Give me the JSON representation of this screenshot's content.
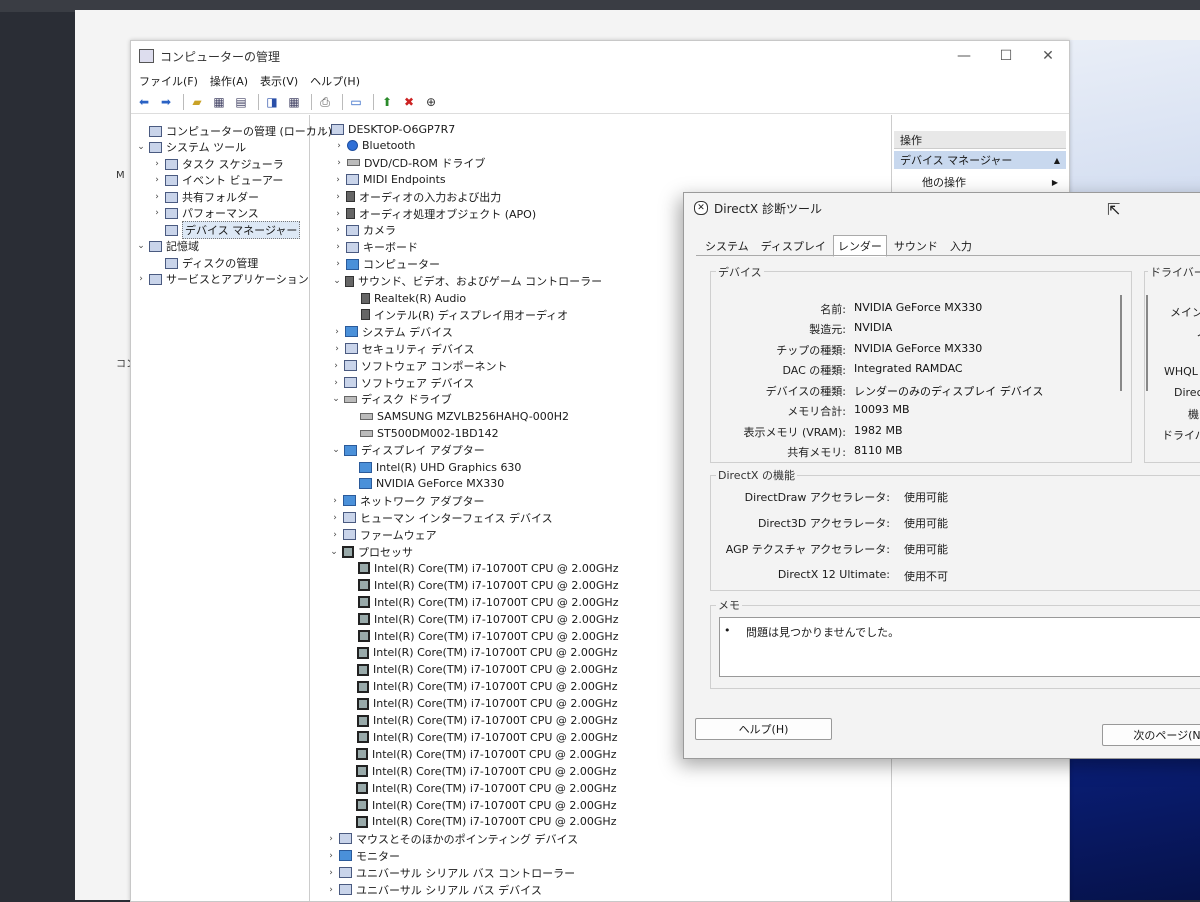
{
  "computer_management": {
    "title": "コンピューターの管理",
    "window_controls": [
      "—",
      "☐",
      "✕"
    ],
    "menu": [
      "ファイル(F)",
      "操作(A)",
      "表示(V)",
      "ヘルプ(H)"
    ],
    "left_tree": [
      {
        "label": "コンピューターの管理 (ローカル)",
        "expander": "",
        "indent": 0,
        "selected": false
      },
      {
        "label": "システム ツール",
        "expander": "⌄",
        "indent": 1,
        "selected": false
      },
      {
        "label": "タスク スケジューラ",
        "expander": "›",
        "indent": 2,
        "selected": false
      },
      {
        "label": "イベント ビューアー",
        "expander": "›",
        "indent": 2,
        "selected": false
      },
      {
        "label": "共有フォルダー",
        "expander": "›",
        "indent": 2,
        "selected": false
      },
      {
        "label": "パフォーマンス",
        "expander": "›",
        "indent": 2,
        "selected": false
      },
      {
        "label": "デバイス マネージャー",
        "expander": "",
        "indent": 2,
        "selected": true
      },
      {
        "label": "記憶域",
        "expander": "⌄",
        "indent": 1,
        "selected": false
      },
      {
        "label": "ディスクの管理",
        "expander": "",
        "indent": 2,
        "selected": false
      },
      {
        "label": "サービスとアプリケーション",
        "expander": "›",
        "indent": 1,
        "selected": false
      }
    ],
    "device_tree": [
      {
        "label": "DESKTOP-O6GP7R7",
        "expander": "⌄",
        "indent": 0,
        "icon": "computer"
      },
      {
        "label": "Bluetooth",
        "expander": "›",
        "indent": 1,
        "icon": "bluetooth"
      },
      {
        "label": "DVD/CD-ROM ドライブ",
        "expander": "›",
        "indent": 1,
        "icon": "disk"
      },
      {
        "label": "MIDI Endpoints",
        "expander": "›",
        "indent": 1,
        "icon": "device"
      },
      {
        "label": "オーディオの入力および出力",
        "expander": "›",
        "indent": 1,
        "icon": "speaker"
      },
      {
        "label": "オーディオ処理オブジェクト (APO)",
        "expander": "›",
        "indent": 1,
        "icon": "speaker"
      },
      {
        "label": "カメラ",
        "expander": "›",
        "indent": 1,
        "icon": "device"
      },
      {
        "label": "キーボード",
        "expander": "›",
        "indent": 1,
        "icon": "device"
      },
      {
        "label": "コンピューター",
        "expander": "›",
        "indent": 1,
        "icon": "monitor"
      },
      {
        "label": "サウンド、ビデオ、およびゲーム コントローラー",
        "expander": "⌄",
        "indent": 1,
        "icon": "speaker"
      },
      {
        "label": "Realtek(R) Audio",
        "expander": "",
        "indent": 2,
        "icon": "speaker"
      },
      {
        "label": "インテル(R) ディスプレイ用オーディオ",
        "expander": "",
        "indent": 2,
        "icon": "speaker"
      },
      {
        "label": "システム デバイス",
        "expander": "›",
        "indent": 1,
        "icon": "monitor"
      },
      {
        "label": "セキュリティ デバイス",
        "expander": "›",
        "indent": 1,
        "icon": "device"
      },
      {
        "label": "ソフトウェア コンポーネント",
        "expander": "›",
        "indent": 1,
        "icon": "device"
      },
      {
        "label": "ソフトウェア デバイス",
        "expander": "›",
        "indent": 1,
        "icon": "device"
      },
      {
        "label": "ディスク ドライブ",
        "expander": "⌄",
        "indent": 1,
        "icon": "disk"
      },
      {
        "label": "SAMSUNG MZVLB256HAHQ-000H2",
        "expander": "",
        "indent": 2,
        "icon": "disk"
      },
      {
        "label": "ST500DM002-1BD142",
        "expander": "",
        "indent": 2,
        "icon": "disk"
      },
      {
        "label": "ディスプレイ アダプター",
        "expander": "⌄",
        "indent": 1,
        "icon": "monitor"
      },
      {
        "label": "Intel(R) UHD Graphics 630",
        "expander": "",
        "indent": 2,
        "icon": "monitor"
      },
      {
        "label": "NVIDIA GeForce MX330",
        "expander": "",
        "indent": 2,
        "icon": "monitor"
      },
      {
        "label": "ネットワーク アダプター",
        "expander": "›",
        "indent": 1,
        "icon": "monitor"
      },
      {
        "label": "ヒューマン インターフェイス デバイス",
        "expander": "›",
        "indent": 1,
        "icon": "device"
      },
      {
        "label": "ファームウェア",
        "expander": "›",
        "indent": 1,
        "icon": "device"
      },
      {
        "label": "プロセッサ",
        "expander": "⌄",
        "indent": 1,
        "icon": "chip"
      },
      {
        "label": "Intel(R) Core(TM) i7-10700T CPU @ 2.00GHz",
        "expander": "",
        "indent": 2,
        "icon": "chip"
      },
      {
        "label": "Intel(R) Core(TM) i7-10700T CPU @ 2.00GHz",
        "expander": "",
        "indent": 2,
        "icon": "chip"
      },
      {
        "label": "Intel(R) Core(TM) i7-10700T CPU @ 2.00GHz",
        "expander": "",
        "indent": 2,
        "icon": "chip"
      },
      {
        "label": "Intel(R) Core(TM) i7-10700T CPU @ 2.00GHz",
        "expander": "",
        "indent": 2,
        "icon": "chip"
      },
      {
        "label": "Intel(R) Core(TM) i7-10700T CPU @ 2.00GHz",
        "expander": "",
        "indent": 2,
        "icon": "chip"
      },
      {
        "label": "Intel(R) Core(TM) i7-10700T CPU @ 2.00GHz",
        "expander": "",
        "indent": 2,
        "icon": "chip"
      },
      {
        "label": "Intel(R) Core(TM) i7-10700T CPU @ 2.00GHz",
        "expander": "",
        "indent": 2,
        "icon": "chip"
      },
      {
        "label": "Intel(R) Core(TM) i7-10700T CPU @ 2.00GHz",
        "expander": "",
        "indent": 2,
        "icon": "chip"
      },
      {
        "label": "Intel(R) Core(TM) i7-10700T CPU @ 2.00GHz",
        "expander": "",
        "indent": 2,
        "icon": "chip"
      },
      {
        "label": "Intel(R) Core(TM) i7-10700T CPU @ 2.00GHz",
        "expander": "",
        "indent": 2,
        "icon": "chip"
      },
      {
        "label": "Intel(R) Core(TM) i7-10700T CPU @ 2.00GHz",
        "expander": "",
        "indent": 2,
        "icon": "chip"
      },
      {
        "label": "Intel(R) Core(TM) i7-10700T CPU @ 2.00GHz",
        "expander": "",
        "indent": 2,
        "icon": "chip"
      },
      {
        "label": "Intel(R) Core(TM) i7-10700T CPU @ 2.00GHz",
        "expander": "",
        "indent": 2,
        "icon": "chip"
      },
      {
        "label": "Intel(R) Core(TM) i7-10700T CPU @ 2.00GHz",
        "expander": "",
        "indent": 2,
        "icon": "chip"
      },
      {
        "label": "Intel(R) Core(TM) i7-10700T CPU @ 2.00GHz",
        "expander": "",
        "indent": 2,
        "icon": "chip"
      },
      {
        "label": "Intel(R) Core(TM) i7-10700T CPU @ 2.00GHz",
        "expander": "",
        "indent": 2,
        "icon": "chip"
      },
      {
        "label": "マウスとそのほかのポインティング デバイス",
        "expander": "›",
        "indent": 1,
        "icon": "device"
      },
      {
        "label": "モニター",
        "expander": "›",
        "indent": 1,
        "icon": "monitor"
      },
      {
        "label": "ユニバーサル シリアル バス コントローラー",
        "expander": "›",
        "indent": 1,
        "icon": "device"
      },
      {
        "label": "ユニバーサル シリアル バス デバイス",
        "expander": "›",
        "indent": 1,
        "icon": "device"
      }
    ],
    "actions": {
      "header": "操作",
      "selected": "デバイス マネージャー",
      "item": "他の操作"
    }
  },
  "directx": {
    "title": "DirectX 診断ツール",
    "tabs": [
      "システム",
      "ディスプレイ",
      "レンダー",
      "サウンド",
      "入力"
    ],
    "active_tab": 2,
    "device_group": "デバイス",
    "driver_group": "ドライバー",
    "device": [
      {
        "label": "名前:",
        "value": "NVIDIA GeForce MX330"
      },
      {
        "label": "製造元:",
        "value": "NVIDIA"
      },
      {
        "label": "チップの種類:",
        "value": "NVIDIA GeForce MX330"
      },
      {
        "label": "DAC の種類:",
        "value": "Integrated RAMDAC"
      },
      {
        "label": "デバイスの種類:",
        "value": "レンダーのみのディスプレイ デバイス"
      },
      {
        "label": "メモリ合計:",
        "value": "10093 MB"
      },
      {
        "label": "表示メモリ (VRAM):",
        "value": "1982 MB"
      },
      {
        "label": "共有メモリ:",
        "value": "8110 MB"
      }
    ],
    "driver_partial": [
      "メイン",
      "ノ",
      "WHQL",
      "Direc",
      "機",
      "ドライバ"
    ],
    "features_group": "DirectX の機能",
    "features": [
      {
        "label": "DirectDraw アクセラレータ:",
        "value": "使用可能"
      },
      {
        "label": "Direct3D アクセラレータ:",
        "value": "使用可能"
      },
      {
        "label": "AGP テクスチャ アクセラレータ:",
        "value": "使用可能"
      },
      {
        "label": "DirectX 12 Ultimate:",
        "value": "使用不可"
      }
    ],
    "notes_group": "メモ",
    "notes_bullet": "•",
    "notes_text": "問題は見つかりませんでした。",
    "help_button": "ヘルプ(H)",
    "next_button": "次のページ(N"
  },
  "desktop_glyphs": [
    "M",
    "コン"
  ]
}
